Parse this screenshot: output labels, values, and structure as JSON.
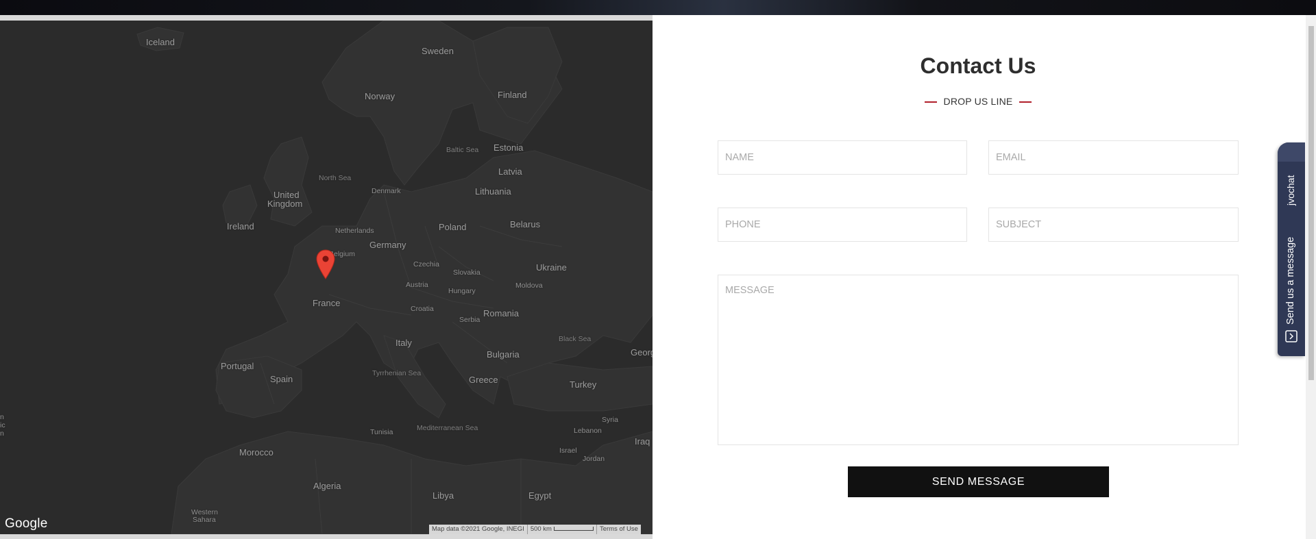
{
  "map": {
    "labels": {
      "iceland": "Iceland",
      "sweden": "Sweden",
      "norway": "Norway",
      "finland": "Finland",
      "baltic_sea": "Baltic Sea",
      "estonia": "Estonia",
      "latvia": "Latvia",
      "north_sea": "North Sea",
      "denmark": "Denmark",
      "lithuania": "Lithuania",
      "united_kingdom_line1": "United",
      "united_kingdom_line2": "Kingdom",
      "ireland": "Ireland",
      "netherlands": "Netherlands",
      "poland": "Poland",
      "belarus": "Belarus",
      "belgium": "Belgium",
      "germany": "Germany",
      "czechia": "Czechia",
      "slovakia": "Slovakia",
      "ukraine": "Ukraine",
      "austria": "Austria",
      "moldova": "Moldova",
      "hungary": "Hungary",
      "france": "France",
      "romania": "Romania",
      "croatia": "Croatia",
      "serbia": "Serbia",
      "italy": "Italy",
      "black_sea": "Black Sea",
      "georgia": "Georg",
      "bulgaria": "Bulgaria",
      "portugal": "Portugal",
      "spain": "Spain",
      "tyrrhenian_sea": "Tyrrhenian Sea",
      "greece": "Greece",
      "turkey": "Turkey",
      "syria": "Syria",
      "lebanon": "Lebanon",
      "tunisia": "Tunisia",
      "mediterranean_sea": "Mediterranean Sea",
      "iraq": "Iraq",
      "israel": "Israel",
      "jordan": "Jordan",
      "morocco": "Morocco",
      "algeria": "Algeria",
      "libya": "Libya",
      "egypt": "Egypt",
      "western_sahara_line1": "Western",
      "western_sahara_line2": "Sahara",
      "edge_fragment": "n\nic\nn"
    },
    "logo": "Google",
    "map_data": "Map data ©2021 Google, INEGI",
    "scale": "500 km",
    "terms": "Terms of Use"
  },
  "contact": {
    "title": "Contact Us",
    "subtitle": "DROP US LINE",
    "fields": {
      "name_placeholder": "NAME",
      "email_placeholder": "EMAIL",
      "phone_placeholder": "PHONE",
      "subject_placeholder": "SUBJECT",
      "message_placeholder": "MESSAGE"
    },
    "send_label": "SEND MESSAGE"
  },
  "chat": {
    "brand": "jvochat",
    "cta": "Send us a message",
    "icon": "message-icon"
  },
  "colors": {
    "accent": "#b11f2a",
    "map_bg": "#2b2b2b",
    "chat_bg": "#2f3855",
    "button_bg": "#111111"
  }
}
